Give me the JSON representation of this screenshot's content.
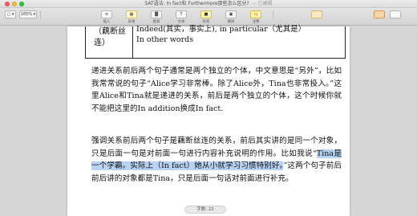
{
  "window": {
    "title": "SAT语法: In fact和 Furthermore那些怎么区分?",
    "subtitle": "— 已编辑"
  },
  "toolbar": {
    "view_label": "▢ ▾",
    "zoom_value": "165% ▾",
    "insert_icon_char": "≡",
    "insert_label": "插入",
    "table_icon_char": "▦",
    "table_label": "表格",
    "chart_icon_char": "▓",
    "chart_label": "图表",
    "text_icon_char": "T",
    "text_label": "文本",
    "shape_icon_char": "■",
    "shape_label": "形状",
    "media_icon_char": "▣",
    "media_label": "媒体",
    "comment_icon_char": "▭",
    "comment_label": "注释"
  },
  "table_snippet": {
    "left_cell": "（藕断丝连）",
    "right_line1": "Indeed(其实，事实上), in particular（尤其是）",
    "right_line2": "In other words"
  },
  "paragraph1": "递进关系前后两个句子通常是两个独立的个体，中文意思是“另外”，比如我常常说的句子“Alice学习非常棒。除了Alice外，Tina也非常投入。”这里Alice和Tina就是递进的关系，前后是两个独立的个体，这个时候你就不能把这里的In addition换成In fact.",
  "paragraph2": {
    "before": "强调关系前后两个句子是藕断丝连的关系，前后其实讲的是同一个对象，只是后面一句是对前面一句进行内容补充说明的作用。比如我说“",
    "highlight": "Tina是一个学霸。实际上（In fact）她从小就学习习惯特别好。",
    "after": "”这两个句子前后前后讲的对象都是Tina，只是后面一句话对前面进行补充。"
  },
  "page_indicator": "字数: 22"
}
